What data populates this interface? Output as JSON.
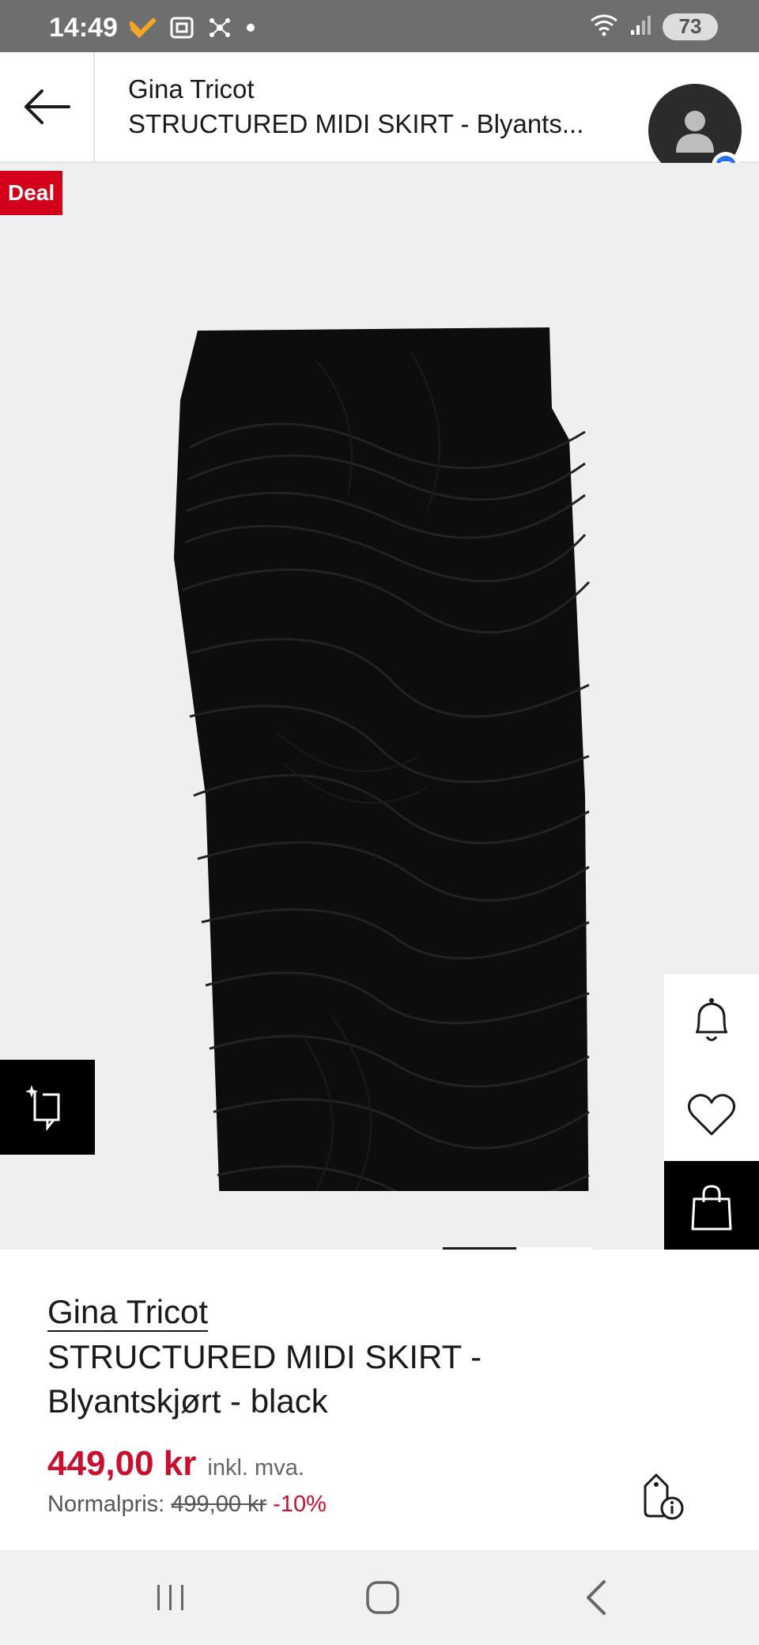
{
  "status_bar": {
    "time": "14:49",
    "battery": "73",
    "icons": [
      "notification-icon",
      "screenshot-icon",
      "network-icon",
      "dot-icon",
      "wifi-icon",
      "signal-icon",
      "battery-icon"
    ]
  },
  "header": {
    "brand": "Gina Tricot",
    "title": "STRUCTURED MIDI SKIRT - Blyants..."
  },
  "image": {
    "deal_label": "Deal",
    "carousel_page": 1,
    "carousel_total": 2
  },
  "product": {
    "brand": "Gina Tricot",
    "name": "STRUCTURED MIDI SKIRT - Blyantskjørt - black",
    "price": "449,00 kr",
    "vat_note": "inkl. mva.",
    "normal_label": "Normalpris:",
    "old_price": "499,00 kr",
    "discount": "-10%"
  },
  "colors": {
    "deal_red": "#d40019",
    "price_red": "#c8102e",
    "image_bg": "#efeff1"
  }
}
